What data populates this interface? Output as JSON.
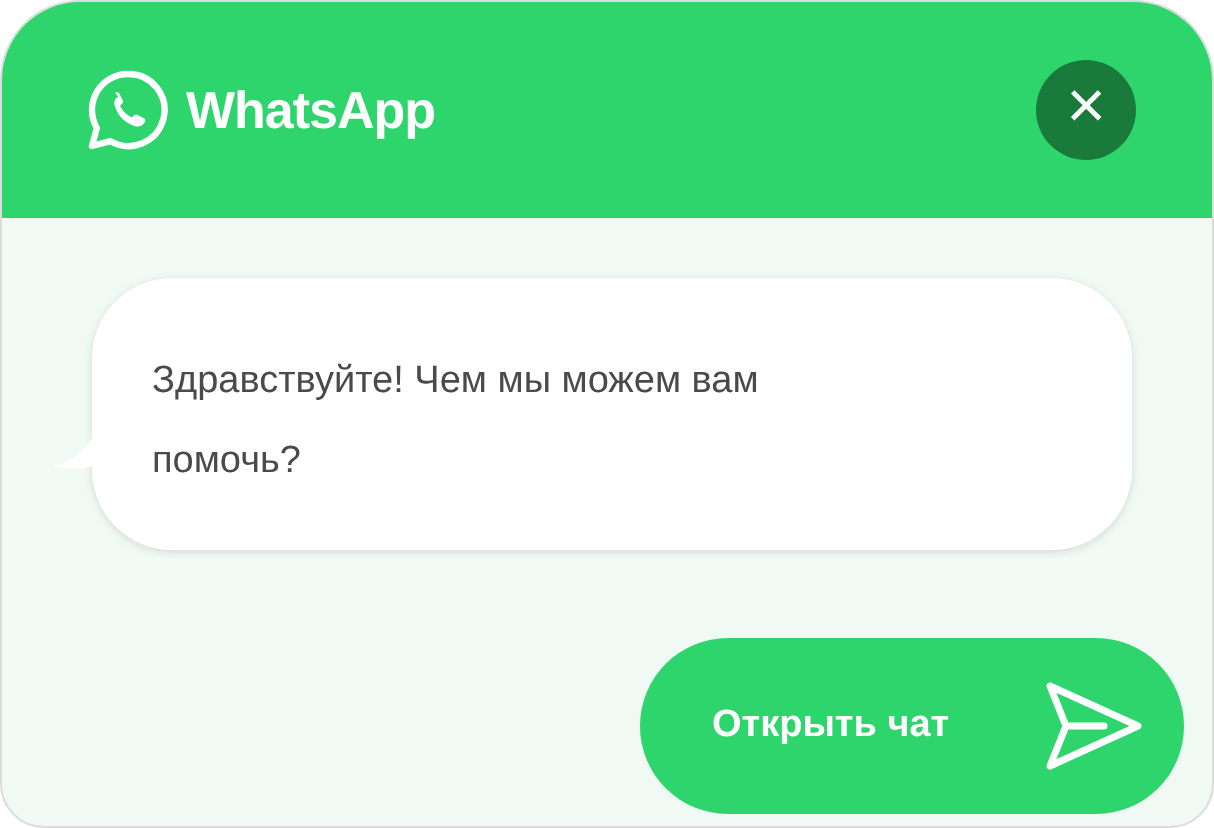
{
  "header": {
    "title": "WhatsApp",
    "close_symbol": "×"
  },
  "message": {
    "text": "Здравствуйте! Чем мы можем вам помочь?"
  },
  "open_button": {
    "label": "Открыть чат"
  }
}
